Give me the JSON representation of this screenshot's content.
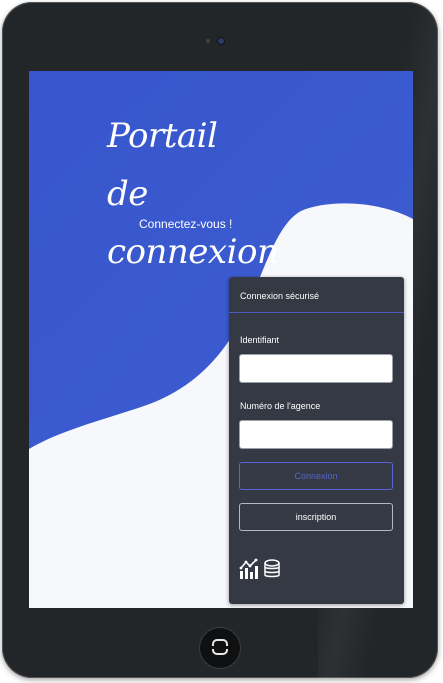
{
  "hero": {
    "title": "Portail de connexion",
    "subtitle": "Connectez-vous !"
  },
  "login_panel": {
    "header": "Connexion sécurisé",
    "identifier_label": "Identifiant",
    "identifier_value": "",
    "agency_label": "Numéro de l'agence",
    "agency_value": "",
    "connect_button": "Connexion",
    "register_button": "inscription"
  },
  "icons": [
    "chart-icon",
    "coins-stack-icon"
  ],
  "colors": {
    "accent_blue": "#3b56cc",
    "panel": "#353944",
    "tablet_frame": "#232629"
  }
}
